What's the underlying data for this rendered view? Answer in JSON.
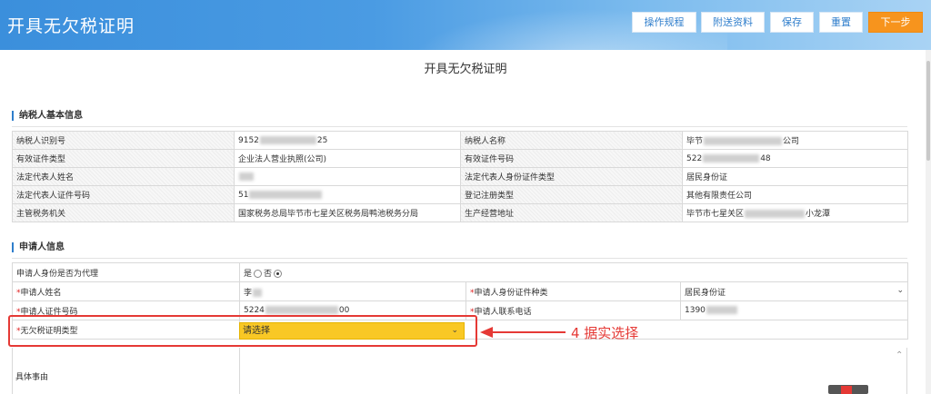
{
  "header": {
    "title": "开具无欠税证明",
    "buttons": {
      "guide": "操作规程",
      "attach": "附送资料",
      "save": "保存",
      "reset": "重置",
      "next": "下一步"
    }
  },
  "page_title": "开具无欠税证明",
  "taxpayer": {
    "section_title": "纳税人基本信息",
    "rows": [
      {
        "l1": "纳税人识别号",
        "v1a": "9152",
        "v1b": "25",
        "l2": "纳税人名称",
        "v2a": "毕节",
        "v2b": "公司"
      },
      {
        "l1": "有效证件类型",
        "v1a": "企业法人营业执照(公司)",
        "v1b": "",
        "l2": "有效证件号码",
        "v2a": "522",
        "v2b": "48"
      },
      {
        "l1": "法定代表人姓名",
        "v1a": "",
        "v1b": "",
        "l2": "法定代表人身份证件类型",
        "v2a": "居民身份证",
        "v2b": ""
      },
      {
        "l1": "法定代表人证件号码",
        "v1a": "51",
        "v1b": "",
        "l2": "登记注册类型",
        "v2a": "其他有限责任公司",
        "v2b": ""
      },
      {
        "l1": "主管税务机关",
        "v1a": "国家税务总局毕节市七星关区税务局鸭池税务分局",
        "v1b": "",
        "l2": "生产经营地址",
        "v2a": "毕节市七星关区",
        "v2b": "小龙潭"
      }
    ]
  },
  "applicant": {
    "section_title": "申请人信息",
    "agent_label": "申请人身份是否为代理",
    "agent_yes": "是",
    "agent_no": "否",
    "name_label": "申请人姓名",
    "name_value": "李",
    "id_type_label": "申请人身份证件种类",
    "id_type_value": "居民身份证",
    "id_no_label": "申请人证件号码",
    "id_no_value": "5224",
    "id_no_tail": "00",
    "phone_label": "申请人联系电话",
    "phone_value": "1390",
    "cert_type_label": "无欠税证明类型",
    "cert_type_value": "请选择",
    "reason_label": "具体事由",
    "required_mark": "*"
  },
  "annotation": {
    "note": "4 据实选择"
  },
  "colors": {
    "header_blue": "#3b8fdc",
    "next_button": "#f7941d",
    "highlight_red": "#e53935",
    "dropdown_yellow": "#f9c825"
  }
}
